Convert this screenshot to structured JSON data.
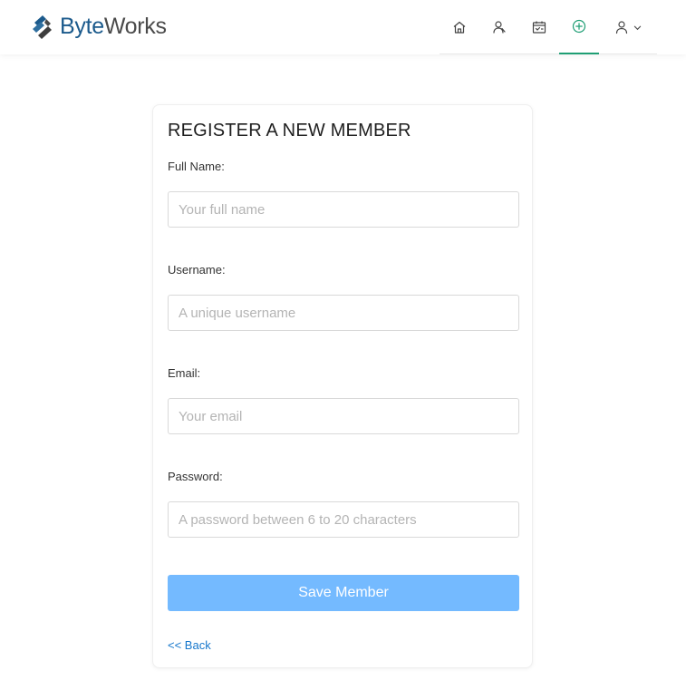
{
  "brand": {
    "name_part1": "Byte",
    "name_part2": "Works",
    "primary_color": "#1b5a8c",
    "accent_color": "#1f9e74"
  },
  "nav": {
    "items": [
      {
        "icon": "home-icon",
        "active": false
      },
      {
        "icon": "members-icon",
        "active": false
      },
      {
        "icon": "calendar-icon",
        "active": false
      },
      {
        "icon": "add-circle-icon",
        "active": true
      },
      {
        "icon": "user-icon",
        "active": false,
        "has_dropdown": true
      }
    ]
  },
  "form": {
    "title": "REGISTER A NEW MEMBER",
    "fields": [
      {
        "label": "Full Name:",
        "placeholder": "Your full name",
        "value": ""
      },
      {
        "label": "Username:",
        "placeholder": "A unique username",
        "value": ""
      },
      {
        "label": "Email:",
        "placeholder": "Your email",
        "value": ""
      },
      {
        "label": "Password:",
        "placeholder": "A password between 6 to 20 characters",
        "value": ""
      }
    ],
    "save_label": "Save Member",
    "back_label": "<< Back",
    "button_color": "#74baff",
    "link_color": "#1677cc"
  }
}
